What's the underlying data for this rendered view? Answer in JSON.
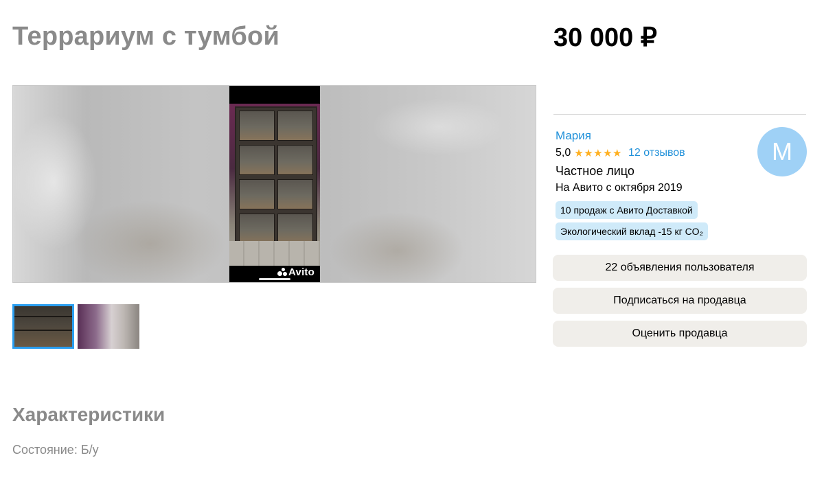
{
  "listing": {
    "title": "Террариум с тумбой",
    "price": "30 000 ₽"
  },
  "gallery": {
    "watermark": "Avito",
    "thumbnails_count": 2,
    "selected_thumbnail": 1
  },
  "seller": {
    "name": "Мария",
    "rating": "5,0",
    "stars": "★★★★★",
    "reviews": "12 отзывов",
    "type": "Частное лицо",
    "since": "На Авито с октября 2019",
    "avatar_letter": "M",
    "badges": [
      "10 продаж с Авито Доставкой",
      "Экологический вклад -15 кг CO₂"
    ],
    "buttons": [
      "22 объявления пользователя",
      "Подписаться на продавца",
      "Оценить продавца"
    ]
  },
  "characteristics": {
    "title": "Характеристики",
    "condition_label": "Состояние:",
    "condition_value": "Б/у"
  },
  "colors": {
    "link": "#1f90d9",
    "star": "#ffb021",
    "badge_bg": "#cfeaf9",
    "avatar_bg": "#9fd1f6",
    "button_bg": "#f0eeea",
    "muted_text": "#8a8a8a",
    "thumb_selected_border": "#2a9ef0"
  }
}
